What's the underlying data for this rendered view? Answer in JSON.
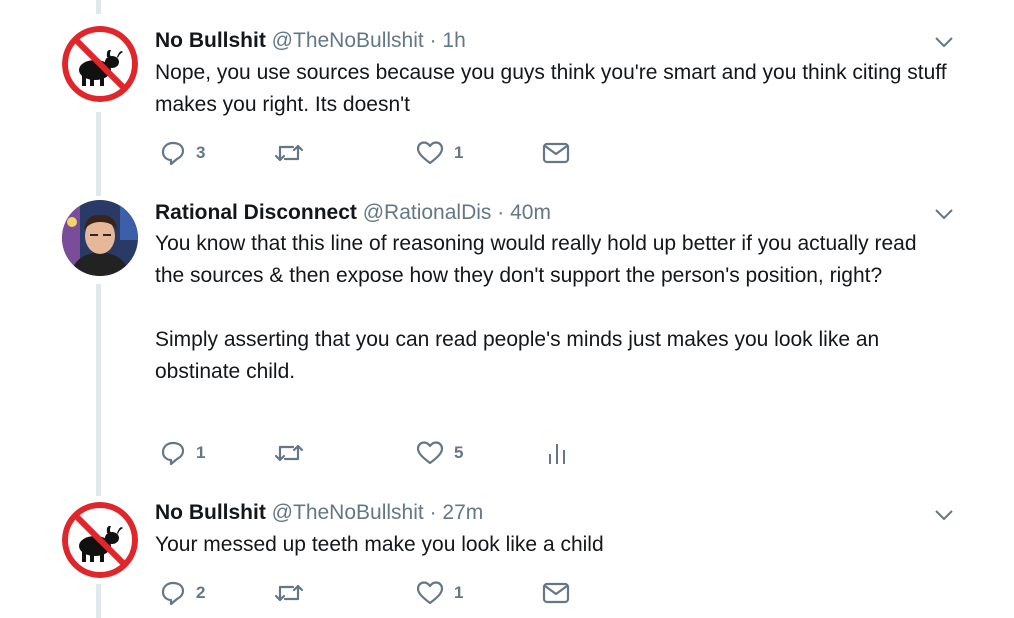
{
  "tweets": [
    {
      "name": "No Bullshit",
      "handle": "@TheNoBullshit",
      "separator": "·",
      "time": "1h",
      "text": "Nope, you use sources because you guys think you're smart and you think citing stuff makes you right. Its doesn't",
      "reply_count": "3",
      "retweet_count": "",
      "like_count": "1",
      "avatar_icon": "no-bull-sign-icon",
      "fourth_action_icon": "envelope-icon"
    },
    {
      "name": "Rational Disconnect",
      "handle": "@RationalDis",
      "separator": "·",
      "time": "40m",
      "text": "You know that this line of reasoning would really hold up better if you actually read the sources & then expose how they don't support the person's position, right?\n\nSimply asserting that you can read people's minds just makes you look like an obstinate child.",
      "reply_count": "1",
      "retweet_count": "",
      "like_count": "5",
      "avatar_icon": "profile-photo",
      "fourth_action_icon": "analytics-icon"
    },
    {
      "name": "No Bullshit",
      "handle": "@TheNoBullshit",
      "separator": "·",
      "time": "27m",
      "text": "Your messed up teeth make you look like a child",
      "reply_count": "2",
      "retweet_count": "",
      "like_count": "1",
      "avatar_icon": "no-bull-sign-icon",
      "fourth_action_icon": "envelope-icon"
    }
  ],
  "colors": {
    "text": "#14171a",
    "secondary": "#657786",
    "thread_line": "#e1e8ed",
    "no_sign_red": "#e0262b"
  }
}
